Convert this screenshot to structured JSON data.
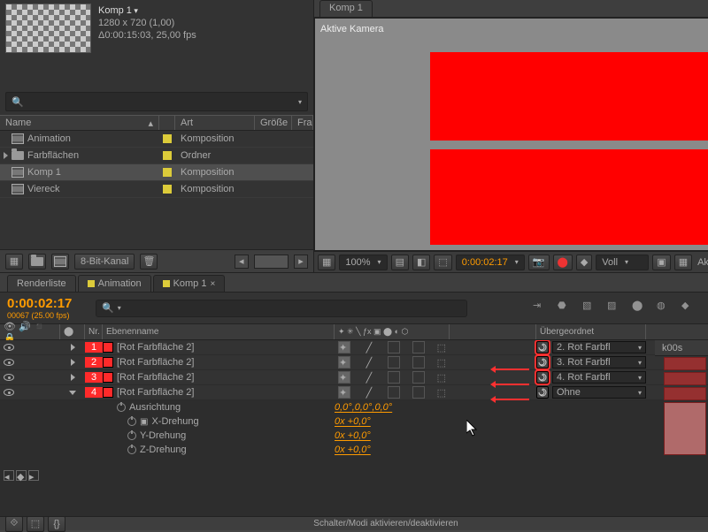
{
  "project": {
    "thumb_title": "Komp 1",
    "thumb_dims": "1280 x 720 (1,00)",
    "thumb_fps": "Δ0:00:15:03, 25,00 fps",
    "search_placeholder": "",
    "cols": {
      "name": "Name",
      "type": "Art",
      "size": "Größe",
      "fps": "Fra"
    },
    "rows": [
      {
        "name": "Animation",
        "type": "Komposition",
        "kind": "comp",
        "selected": false
      },
      {
        "name": "Farbflächen",
        "type": "Ordner",
        "kind": "folder",
        "selected": false
      },
      {
        "name": "Komp 1",
        "type": "Komposition",
        "kind": "comp",
        "selected": true
      },
      {
        "name": "Viereck",
        "type": "Komposition",
        "kind": "comp",
        "selected": false
      }
    ],
    "bitdepth": "8-Bit-Kanal"
  },
  "viewer": {
    "tab": "Komp 1",
    "active_cam": "Aktive Kamera",
    "zoom": "100%",
    "time": "0:00:02:17",
    "res": "Voll",
    "active_label": "Aktive"
  },
  "tabs": {
    "render": "Renderliste",
    "anim": "Animation",
    "comp": "Komp 1"
  },
  "timeline": {
    "time": "0:00:02:17",
    "time_sub": "00067 (25.00 fps)",
    "ruler_start": "k00s",
    "cols": {
      "nr": "Nr.",
      "name": "Ebenenname",
      "parent": "Übergeordnet"
    },
    "layers": [
      {
        "nr": "1",
        "name": "[Rot Farbfläche 2]",
        "parent": "2. Rot Farbfl",
        "open": false,
        "spiral_hl": true,
        "arrow": false
      },
      {
        "nr": "2",
        "name": "[Rot Farbfläche 2]",
        "parent": "3. Rot Farbfl",
        "open": false,
        "spiral_hl": true,
        "arrow": true
      },
      {
        "nr": "3",
        "name": "[Rot Farbfläche 2]",
        "parent": "4. Rot Farbfl",
        "open": false,
        "spiral_hl": true,
        "arrow": true
      },
      {
        "nr": "4",
        "name": "[Rot Farbfläche 2]",
        "parent": "Ohne",
        "open": true,
        "spiral_hl": false,
        "arrow": true
      }
    ],
    "props": [
      {
        "name": "Ausrichtung",
        "value": "0,0°,0,0°,0,0°"
      },
      {
        "name": "X-Drehung",
        "value": "0x +0,0°"
      },
      {
        "name": "Y-Drehung",
        "value": "0x +0,0°"
      },
      {
        "name": "Z-Drehung",
        "value": "0x +0,0°"
      }
    ],
    "footer_msg": "Schalter/Modi aktivieren/deaktivieren"
  }
}
